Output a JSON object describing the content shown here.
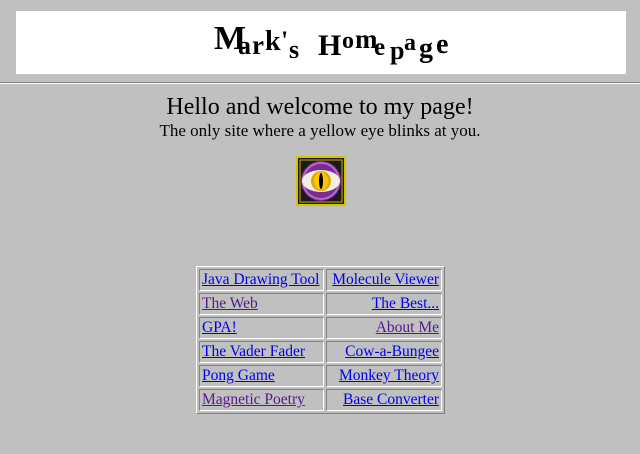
{
  "banner": {
    "title": "Mark's Homepage",
    "letters": [
      "M",
      "a",
      "r",
      "k",
      "'",
      "s",
      "H",
      "o",
      "m",
      "e",
      "p",
      "a",
      "g",
      "e"
    ]
  },
  "welcome": {
    "heading": "Hello and welcome to my page!",
    "tagline": "The only site where a yellow eye blinks at you."
  },
  "eye_image": {
    "icon": "blinking-yellow-eye-icon",
    "colors": {
      "border": "#d8c200",
      "iris": "#8a3fa0",
      "pupil": "#f0b000"
    }
  },
  "links": [
    {
      "left": {
        "label": "Java Drawing Tool",
        "visited": false
      },
      "right": {
        "label": "Molecule Viewer",
        "visited": false
      }
    },
    {
      "left": {
        "label": "The Web",
        "visited": true
      },
      "right": {
        "label": "The Best...",
        "visited": false
      }
    },
    {
      "left": {
        "label": "GPA!",
        "visited": false
      },
      "right": {
        "label": "About Me",
        "visited": true
      }
    },
    {
      "left": {
        "label": "The Vader Fader",
        "visited": false
      },
      "right": {
        "label": "Cow-a-Bungee",
        "visited": false
      }
    },
    {
      "left": {
        "label": "Pong Game",
        "visited": false
      },
      "right": {
        "label": "Monkey Theory",
        "visited": false
      }
    },
    {
      "left": {
        "label": "Magnetic Poetry",
        "visited": true
      },
      "right": {
        "label": "Base Converter",
        "visited": false
      }
    }
  ],
  "colors": {
    "page_background": "#c0c0c0",
    "banner_background": "#ffffff",
    "link": "#0000ee",
    "visited_link": "#551a8b"
  }
}
